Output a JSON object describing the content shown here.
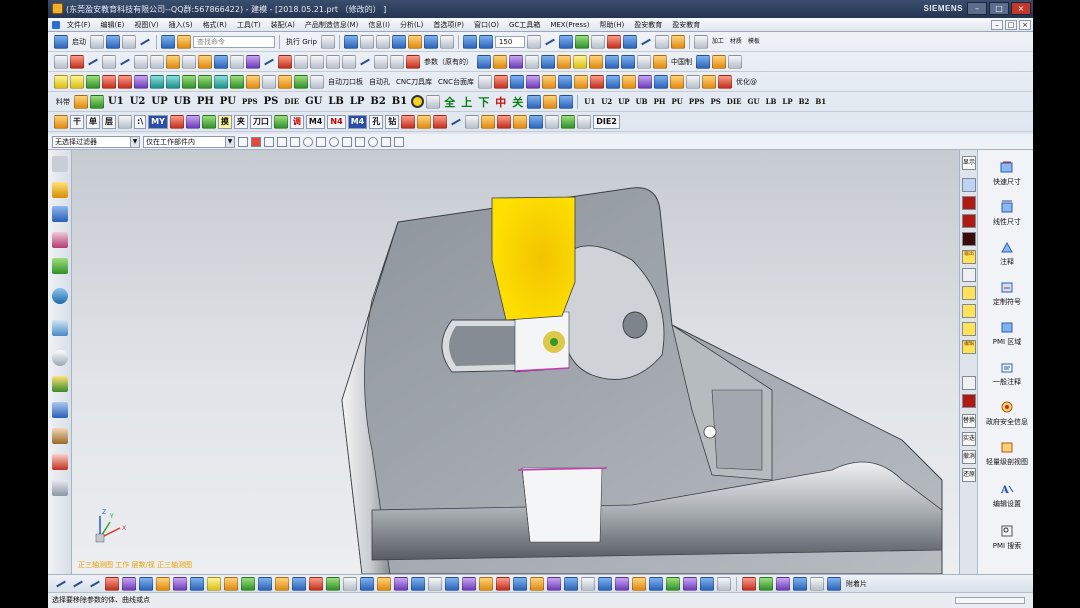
{
  "window": {
    "title": "(东莞盈安教育科技有限公司--QQ群:567866422) - 建模 - [2018.05.21.prt （修改的） ]",
    "brand": "SIEMENS",
    "buttons": {
      "minimize": "–",
      "maximize": "□",
      "close": "×"
    }
  },
  "menubar": {
    "items": [
      "文件(F)",
      "编辑(E)",
      "视图(V)",
      "插入(S)",
      "格式(R)",
      "工具(T)",
      "装配(A)",
      "产品制造信息(M)",
      "信息(I)",
      "分析(L)",
      "首选项(P)",
      "窗口(O)",
      "GC工具箱",
      "MEX(Press)",
      "帮助(H)",
      "盈安教育",
      "盈安教育"
    ]
  },
  "toolbar": {
    "start_label": "启动",
    "search_placeholder": "查找命令",
    "grip_label": "执行 Grip",
    "zoom_value": "150",
    "process_label": "加工",
    "material_label": "材质",
    "model_label": "模板",
    "row2_params": "参数（原有的）",
    "row2_china": "中国制",
    "row3_texts": [
      "自动刀口板",
      "自动孔",
      "CNC刀具库",
      "CNC台面库"
    ],
    "row3_optimize": "优化@",
    "row4_label": "料带",
    "row4_cmds": [
      "U1",
      "U2",
      "UP",
      "UB",
      "PH",
      "PU",
      "PPS",
      "PS",
      "DIE",
      "GU",
      "LB",
      "LP",
      "B2",
      "B1"
    ],
    "row4_hanzi": [
      "全",
      "上",
      "下",
      "中",
      "关"
    ],
    "row4_cmds2": [
      "U1",
      "U2",
      "UP",
      "UB",
      "PH",
      "PU",
      "PPS",
      "PS",
      "DIE",
      "GU",
      "LB",
      "LP",
      "B2",
      "B1"
    ],
    "row5_texts": [
      "干",
      "单",
      "层",
      ":\\",
      "MY",
      "摸",
      "夹",
      "刀口",
      "调",
      "M4",
      "N4",
      "M4",
      "孔",
      "钻",
      "DIE2"
    ]
  },
  "filterbar": {
    "type_filter": "无选择过滤器",
    "scope_filter": "仅在工作部件内"
  },
  "viewport": {
    "info_text": "正三轴测图 工作 层数/视 正三轴测图",
    "triad": {
      "x": "X",
      "y": "Y",
      "z": "Z"
    }
  },
  "rightstrip": {
    "items": [
      "显示",
      "输出",
      "编辑"
    ],
    "texts": [
      "替换",
      "实迭",
      "撤消",
      "还原"
    ]
  },
  "pmi_panel": {
    "items": [
      "快速尺寸",
      "线性尺寸",
      "注释",
      "定制符号",
      "PMI 区域",
      "一般注释",
      "政府安全信息",
      "轻量级剖视图",
      "编辑设置",
      "PMI 搜索"
    ]
  },
  "bottomtoolbar": {
    "label": "附着片"
  },
  "statusbar": {
    "text": "选择要移除参数的体、曲线或点"
  },
  "colors": {
    "title_bar": "#2e4163",
    "highlight_face": "#ffd800",
    "part_body": "#9aa0a6",
    "viewport_bg": "#e1e4e8",
    "section_curve": "#c43bb5"
  }
}
